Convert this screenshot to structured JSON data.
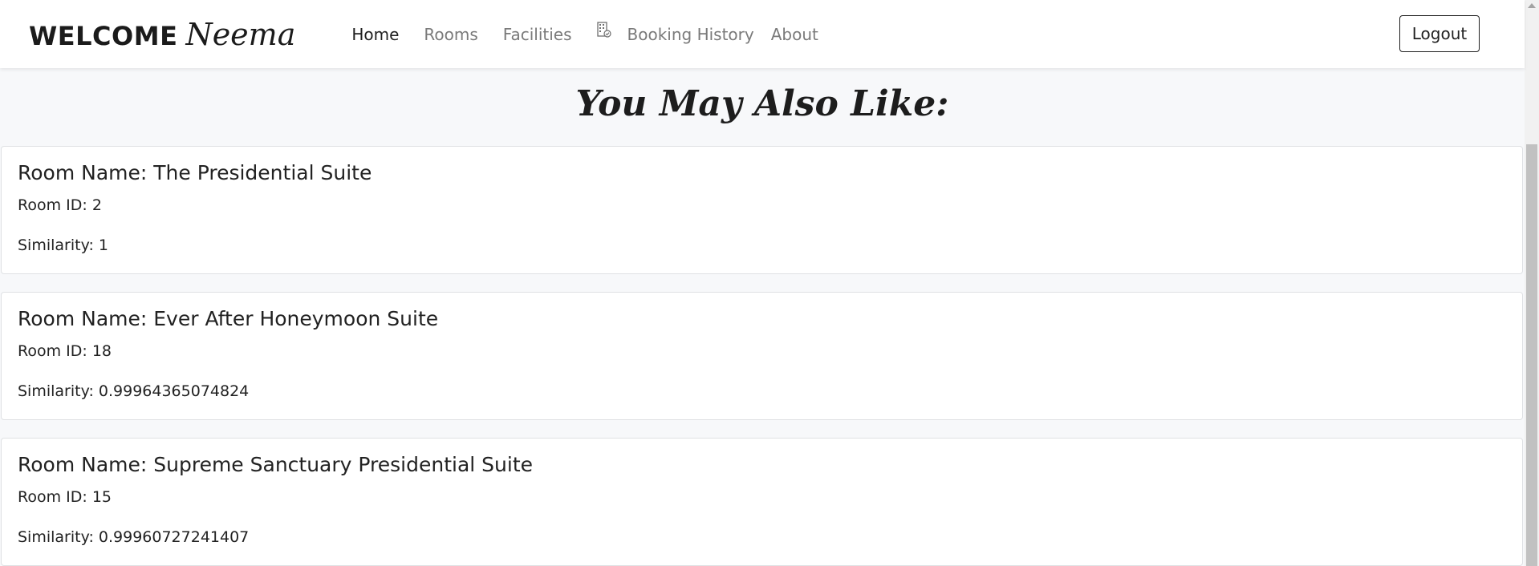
{
  "brand": {
    "welcome": "WELCOME",
    "name": "Neema"
  },
  "nav": {
    "items": [
      {
        "label": "Home"
      },
      {
        "label": "Rooms"
      },
      {
        "label": "Facilities"
      },
      {
        "label": "Booking History",
        "icon": "building-check-icon"
      },
      {
        "label": "About"
      }
    ],
    "logout_label": "Logout"
  },
  "main": {
    "title": "You May Also Like:",
    "rooms": [
      {
        "name": "Room Name: The Presidential Suite",
        "id": "Room ID: 2",
        "similarity": "Similarity: 1"
      },
      {
        "name": "Room Name: Ever After Honeymoon Suite",
        "id": "Room ID: 18",
        "similarity": "Similarity: 0.99964365074824"
      },
      {
        "name": "Room Name: Supreme Sanctuary Presidential Suite",
        "id": "Room ID: 15",
        "similarity": "Similarity: 0.99960727241407"
      }
    ]
  },
  "colors": {
    "page_bg": "#f7f8fa",
    "nav_bg": "#ffffff",
    "active_link": "#1f1f1f",
    "inactive_link": "#7a7a7a"
  }
}
